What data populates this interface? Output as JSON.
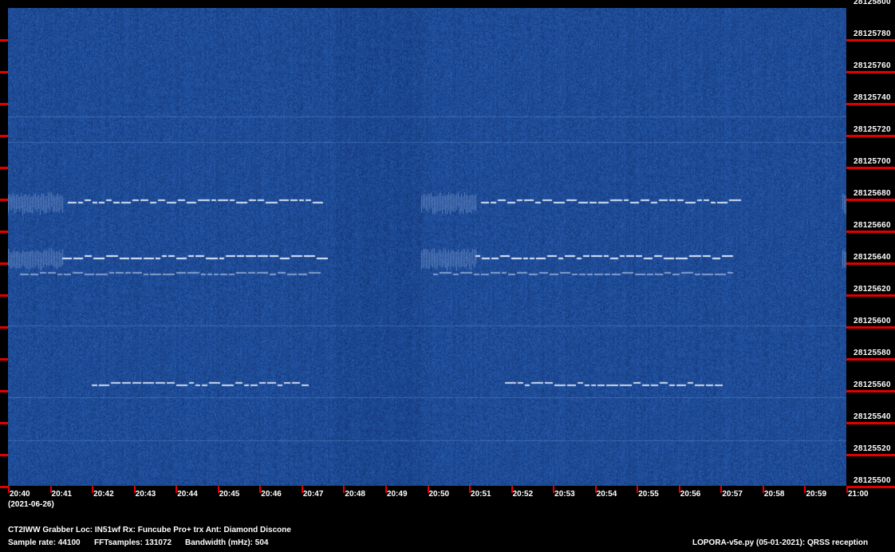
{
  "spectrogram": {
    "background_color": "#2a4f93",
    "trace_color": "#e8f0ff",
    "tick_color": "#e00000",
    "frequency_labels": [
      "28125800",
      "28125780",
      "28125760",
      "28125740",
      "28125720",
      "28125700",
      "28125680",
      "28125660",
      "28125640",
      "28125620",
      "28125600",
      "28125580",
      "28125560",
      "28125540",
      "28125520",
      "28125500"
    ],
    "time_labels": [
      "20:40",
      "20:41",
      "20:42",
      "20:43",
      "20:44",
      "20:45",
      "20:46",
      "20:47",
      "20:48",
      "20:49",
      "20:50",
      "20:51",
      "20:52",
      "20:53",
      "20:54",
      "20:55",
      "20:56",
      "20:57",
      "20:58",
      "20:59",
      "21:00"
    ],
    "date": "(2021-06-26)"
  },
  "footer": {
    "station_line": "CT2IWW Grabber Loc: IN51wf Rx: Funcube Pro+ trx Ant: Diamond Discone",
    "sample_rate": "Sample rate: 44100",
    "fft_samples": "FFTsamples: 131072",
    "bandwidth": "Bandwidth (mHz): 504",
    "software": "LOPORA-v5e.py (05-01-2021): QRSS reception"
  }
}
